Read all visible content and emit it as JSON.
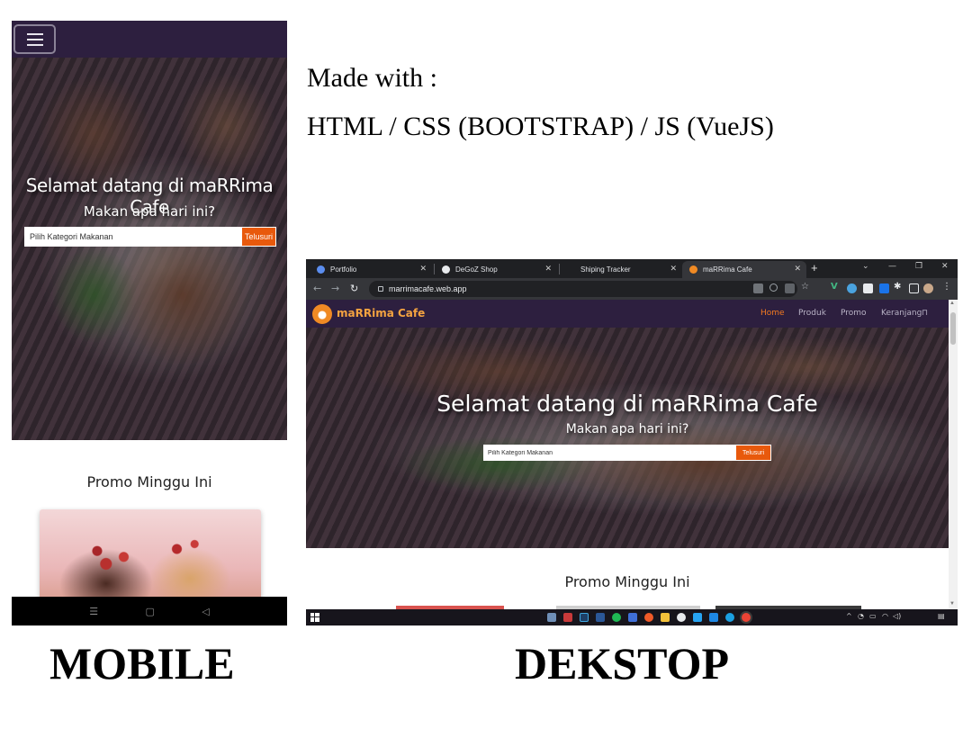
{
  "made_with": {
    "line1": "Made with :",
    "line2": "HTML / CSS (BOOTSTRAP) / JS (VueJS)"
  },
  "labels": {
    "mobile": "MOBILE",
    "desktop": "DEKSTOP"
  },
  "site": {
    "brand": "maRRima Cafe",
    "nav_links": [
      "Home",
      "Produk",
      "Promo",
      "Keranjang"
    ],
    "hero_title": "Selamat datang di maRRima Cafe",
    "hero_subtitle": "Makan apa hari ini?",
    "search_placeholder": "Pilih Kategori Makanan",
    "search_button": "Telusuri",
    "promo_title": "Promo Minggu Ini"
  },
  "browser": {
    "tabs": [
      {
        "title": "Portfolio",
        "icon_color": "#5b8def"
      },
      {
        "title": "DeGoZ Shop",
        "icon_color": "#e8eaed"
      },
      {
        "title": "Shiping Tracker",
        "icon_color": "#2b2c30"
      },
      {
        "title": "maRRima Cafe",
        "icon_color": "#f08a24"
      }
    ],
    "active_tab": 3,
    "url": "marrimacafe.web.app"
  },
  "icons": {
    "hamburger": "hamburger-icon",
    "cart": "cart-icon",
    "close": "close-icon",
    "back": "back-arrow-icon",
    "forward": "forward-arrow-icon",
    "reload": "reload-icon",
    "lock": "lock-icon",
    "windows_start": "windows-start-icon"
  },
  "colors": {
    "navbar": "#2d1f3f",
    "accent": "#e8590c",
    "brand_text": "#f4a340"
  }
}
